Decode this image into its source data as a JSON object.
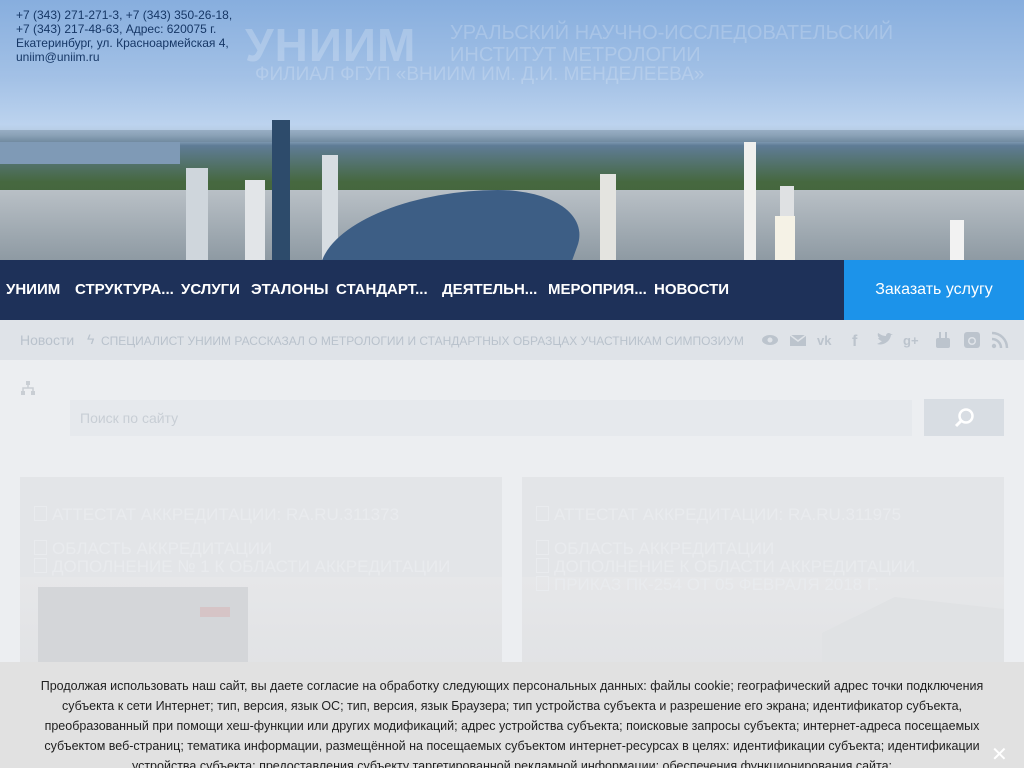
{
  "header": {
    "contacts": "+7 (343) 271-271-3, +7 (343) 350-26-18, +7 (343) 217-48-63, Адрес: 620075 г. Екатеринбург, ул. Красноармейская 4, uniim@uniim.ru",
    "logo_text": "УНИИМ",
    "ghost_line_1": "УРАЛЬСКИЙ НАУЧНО-ИССЛЕДОВАТЕЛЬСКИЙ ИНСТИТУТ МЕТРОЛОГИИ",
    "ghost_line_2": "ФИЛИАЛ ФГУП «ВНИИМ ИМ. Д.И. МЕНДЕЛЕЕВА»"
  },
  "nav": {
    "items": [
      "УНИИМ",
      "СТРУКТУРА...",
      "УСЛУГИ",
      "ЭТАЛОНЫ",
      "СТАНДАРТ...",
      "ДЕЯТЕЛЬН...",
      "МЕРОПРИЯ...",
      "НОВОСТИ"
    ],
    "order_button": "Заказать услугу"
  },
  "breadcrumb": {
    "home": "Новости",
    "current": "СПЕЦИАЛИСТ УНИИМ РАССКАЗАЛ О МЕТРОЛОГИИ И СТАНДАРТНЫХ ОБРАЗЦАХ УЧАСТНИКАМ СИМПОЗИУМ"
  },
  "social_icons": [
    "eye-icon",
    "mail-icon",
    "vk-icon",
    "facebook-icon",
    "twitter-icon",
    "google-plus-icon",
    "youtube-icon",
    "instagram-icon",
    "rss-icon"
  ],
  "search": {
    "placeholder": "Поиск по сайту"
  },
  "cards": [
    {
      "links": [
        "АТТЕСТАТ АККРЕДИТАЦИИ: RA.RU.311373",
        "ОБЛАСТЬ АККРЕДИТАЦИИ",
        "ДОПОЛНЕНИЕ № 1 К ОБЛАСТИ АККРЕДИТАЦИИ"
      ]
    },
    {
      "links": [
        "АТТЕСТАТ АККРЕДИТАЦИИ: RA.RU.311975",
        "ОБЛАСТЬ АККРЕДИТАЦИИ",
        "ДОПОЛНЕНИЕ К ОБЛАСТИ АККРЕДИТАЦИИ.",
        "ПРИКАЗ ПК-254 ОТ 05 ФЕВРАЛЯ 2018 Г."
      ]
    }
  ],
  "cookie": {
    "text": "Продолжая использовать наш сайт, вы даете согласие на обработку следующих персональных данных: файлы cookie; географический адрес точки подключения субъекта к сети Интернет; тип, версия, язык ОС; тип, версия, язык Браузера; тип устройства субъекта и разрешение его экрана; идентификатор субъекта, преобразованный при помощи хеш-функции или других модификаций; адрес устройства субъекта; поисковые запросы субъекта; интернет-адреса посещаемых субъектом веб-страниц; тематика информации, размещённой на посещаемых субъектом интернет-ресурсах в целях: идентификации субъекта; идентификации устройства субъекта; предоставления субъекту таргетированной рекламной информации; обеспечения функционирования сайта;",
    "close": "✕"
  }
}
